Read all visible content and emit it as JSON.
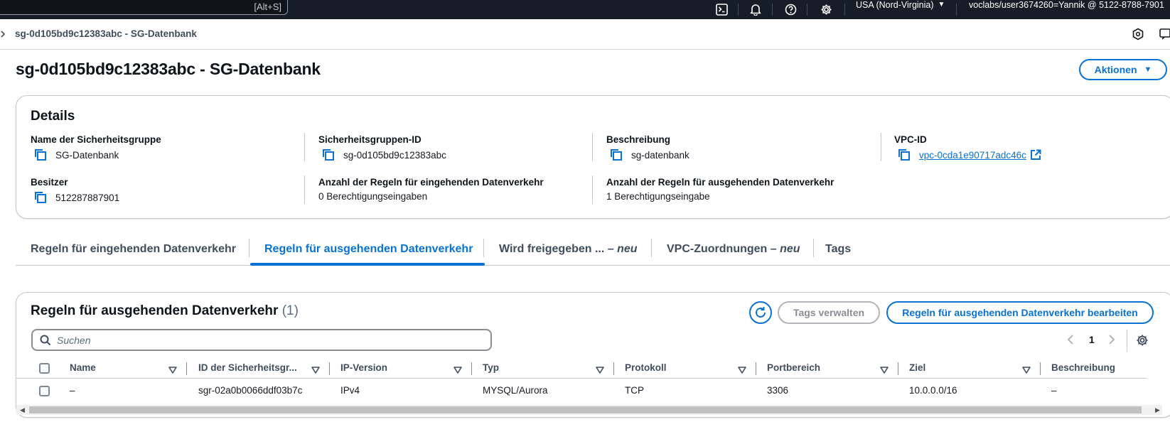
{
  "topbar": {
    "search_shortcut": "[Alt+S]",
    "icons": [
      "cloudshell-icon",
      "bell-icon",
      "help-icon",
      "gear-icon"
    ],
    "region": "USA (Nord-Virginia)",
    "account": "voclabs/user3674260=Yannik @ 5122-8788-7901"
  },
  "breadcrumb": {
    "current": "sg-0d105bd9c12383abc - SG-Datenbank"
  },
  "page": {
    "title": "sg-0d105bd9c12383abc - SG-Datenbank",
    "actions_label": "Aktionen"
  },
  "details": {
    "title": "Details",
    "name_label": "Name der Sicherheitsgruppe",
    "name_value": "SG-Datenbank",
    "id_label": "Sicherheitsgruppen-ID",
    "id_value": "sg-0d105bd9c12383abc",
    "desc_label": "Beschreibung",
    "desc_value": "sg-datenbank",
    "vpc_label": "VPC-ID",
    "vpc_value": "vpc-0cda1e90717adc46c",
    "owner_label": "Besitzer",
    "owner_value": "512287887901",
    "inbound_count_label": "Anzahl der Regeln für eingehenden Datenverkehr",
    "inbound_count_value": "0 Berechtigungseingaben",
    "outbound_count_label": "Anzahl der Regeln für ausgehenden Datenverkehr",
    "outbound_count_value": "1 Berechtigungseingabe"
  },
  "tabs": [
    {
      "label": "Regeln für eingehenden Datenverkehr",
      "suffix": ""
    },
    {
      "label": "Regeln für ausgehenden Datenverkehr",
      "suffix": ""
    },
    {
      "label": "Wird freigegeben ... – ",
      "suffix": "neu"
    },
    {
      "label": "VPC-Zuordnungen – ",
      "suffix": "neu"
    },
    {
      "label": "Tags",
      "suffix": ""
    }
  ],
  "rules_panel": {
    "title": "Regeln für ausgehenden Datenverkehr",
    "count": "(1)",
    "manage_tags_label": "Tags verwalten",
    "edit_label": "Regeln für ausgehenden Datenverkehr bearbeiten",
    "search_placeholder": "Suchen",
    "page_number": "1",
    "columns": [
      "Name",
      "ID der Sicherheitsgr...",
      "IP-Version",
      "Typ",
      "Protokoll",
      "Portbereich",
      "Ziel",
      "Beschreibung"
    ],
    "rows": [
      [
        "–",
        "sgr-02a0b0066ddf03b7c",
        "IPv4",
        "MYSQL/Aurora",
        "TCP",
        "3306",
        "10.0.0.0/16",
        "–"
      ]
    ]
  }
}
